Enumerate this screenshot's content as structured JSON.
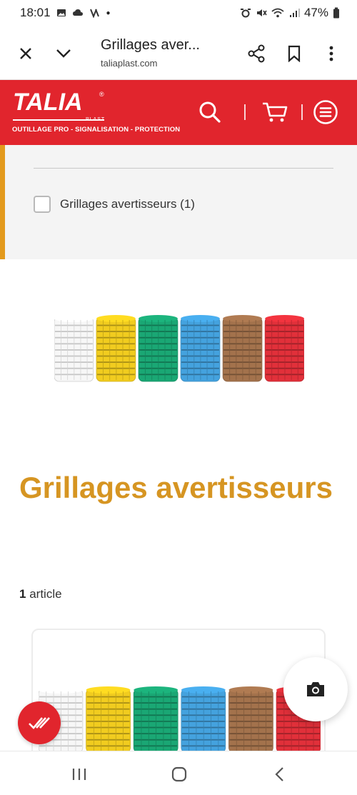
{
  "status_bar": {
    "time": "18:01",
    "battery": "47%"
  },
  "browser": {
    "title": "Grillages aver...",
    "url": "taliaplast.com",
    "icons": [
      "close-icon",
      "chevron-down-icon",
      "share-icon",
      "bookmark-icon",
      "more-vert-icon"
    ]
  },
  "header": {
    "logo": "TALIA",
    "logo_sub": "PLAST",
    "tagline": "OUTILLAGE PRO - SIGNALISATION - PROTECTION",
    "brand_color": "#e1252d",
    "icons": [
      "search-icon",
      "cart-icon",
      "menu-icon"
    ]
  },
  "filter": {
    "accent_color": "#e39a1d",
    "option_label": "Grillages avertisseurs (1)",
    "checked": false
  },
  "category": {
    "title": "Grillages avertisseurs",
    "title_color": "#d69522",
    "count_number": "1",
    "count_word": "article",
    "roll_colors": [
      "#f1f1f1",
      "#f1cc1f",
      "#1aa774",
      "#44a2de",
      "#a3724c",
      "#e1303a"
    ]
  },
  "floating": {
    "camera_icon": "camera-icon",
    "check_icon": "double-check-icon"
  },
  "nav": {
    "icons": [
      "recent-apps-icon",
      "home-icon",
      "back-icon"
    ]
  }
}
